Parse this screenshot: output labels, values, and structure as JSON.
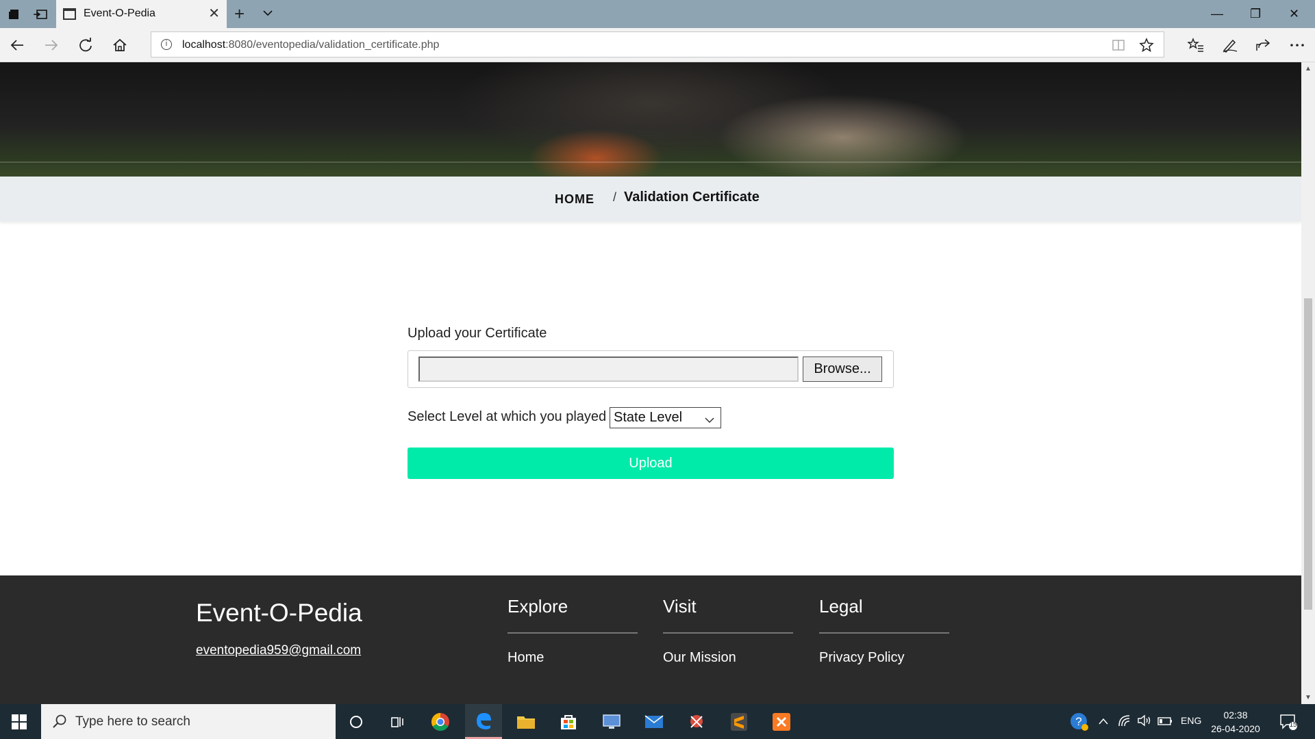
{
  "browser": {
    "tab_title": "Event-O-Pedia",
    "address_host": "localhost",
    "address_path": ":8080/eventopedia/validation_certificate.php",
    "tab_close_glyph": "✕",
    "new_tab_glyph": "+",
    "minimize_glyph": "—",
    "restore_glyph": "❐",
    "close_glyph": "✕"
  },
  "breadcrumb": {
    "home": "HOME",
    "separator": "/",
    "current": "Validation Certificate"
  },
  "form": {
    "upload_label": "Upload your Certificate",
    "browse_label": "Browse...",
    "level_label": "Select Level at which you played",
    "level_selected": "State Level",
    "upload_button": "Upload"
  },
  "footer": {
    "brand": "Event-O-Pedia",
    "email": "eventopedia959@gmail.com",
    "columns": [
      {
        "title": "Explore",
        "link": "Home"
      },
      {
        "title": "Visit",
        "link": "Our Mission"
      },
      {
        "title": "Legal",
        "link": "Privacy Policy"
      }
    ]
  },
  "taskbar": {
    "search_placeholder": "Type here to search",
    "lang": "ENG",
    "time": "02:38",
    "date": "26-04-2020",
    "notifications": "15"
  },
  "colors": {
    "accent": "#00eaaa",
    "footer_bg": "#2b2b2b",
    "breadcrumb_bg": "#e9edf0",
    "tabbar_bg": "#8fa4b2",
    "taskbar_bg": "#1d2b34"
  }
}
